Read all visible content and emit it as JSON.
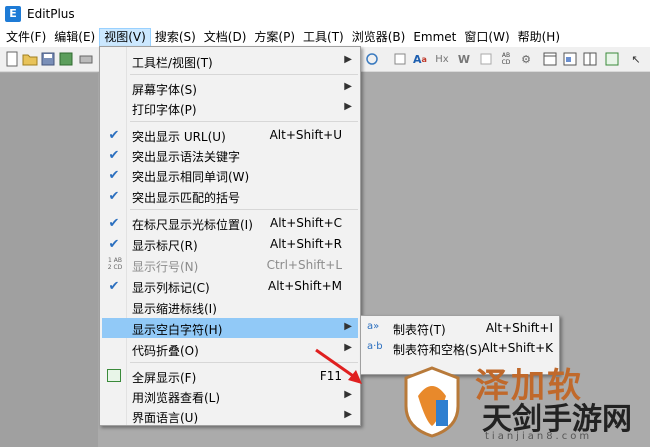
{
  "app": {
    "title": "EditPlus",
    "icon_letter": "E"
  },
  "menubar": [
    {
      "label": "文件(F)",
      "active": false
    },
    {
      "label": "编辑(E)",
      "active": false
    },
    {
      "label": "视图(V)",
      "active": true
    },
    {
      "label": "搜索(S)",
      "active": false
    },
    {
      "label": "文档(D)",
      "active": false
    },
    {
      "label": "方案(P)",
      "active": false
    },
    {
      "label": "工具(T)",
      "active": false
    },
    {
      "label": "浏览器(B)",
      "active": false
    },
    {
      "label": "Emmet",
      "active": false
    },
    {
      "label": "窗口(W)",
      "active": false
    },
    {
      "label": "帮助(H)",
      "active": false
    }
  ],
  "toolbar": {
    "font_glyph": "A",
    "font_sub": "a",
    "hx": "Hx",
    "w_glyph": "W",
    "abc_top": "AB",
    "abc_bot": "CD"
  },
  "view_menu": {
    "toolbar_view": "工具栏/视图(T)",
    "screen_font": "屏幕字体(S)",
    "print_font": "打印字体(P)",
    "highlight_url": "突出显示 URL(U)",
    "highlight_url_sc": "Alt+Shift+U",
    "highlight_keywords": "突出显示语法关键字",
    "highlight_same_words": "突出显示相同单词(W)",
    "highlight_brackets": "突出显示匹配的括号",
    "ruler_cursor": "在标尺显示光标位置(I)",
    "ruler_cursor_sc": "Alt+Shift+C",
    "show_ruler": "显示标尺(R)",
    "show_ruler_sc": "Alt+Shift+R",
    "line_numbers": "显示行号(N)",
    "line_numbers_sc": "Ctrl+Shift+L",
    "line_numbers_icon": "1 AB\n2 CD",
    "column_marker": "显示列标记(C)",
    "column_marker_sc": "Alt+Shift+M",
    "indent_guides": "显示缩进标线(I)",
    "whitespace": "显示空白字符(H)",
    "code_folding": "代码折叠(O)",
    "fullscreen": "全屏显示(F)",
    "fullscreen_sc": "F11",
    "browser_view": "用浏览器查看(L)",
    "ui_language": "界面语言(U)"
  },
  "whitespace_submenu": {
    "tabs": "制表符(T)",
    "tabs_sc": "Alt+Shift+I",
    "tabs_icon": "a»",
    "tabs_spaces": "制表符和空格(S)",
    "tabs_spaces_sc": "Alt+Shift+K",
    "tabs_spaces_icon": "a·b"
  },
  "watermark": {
    "top_text": "泽加软",
    "main_text": "天剑手游网",
    "sub_text": "tianjian8.com"
  },
  "colors": {
    "highlight": "#91c9f7",
    "menu_active": "#cce8ff",
    "check": "#2b6fbf",
    "arrow_red": "#e02020"
  }
}
